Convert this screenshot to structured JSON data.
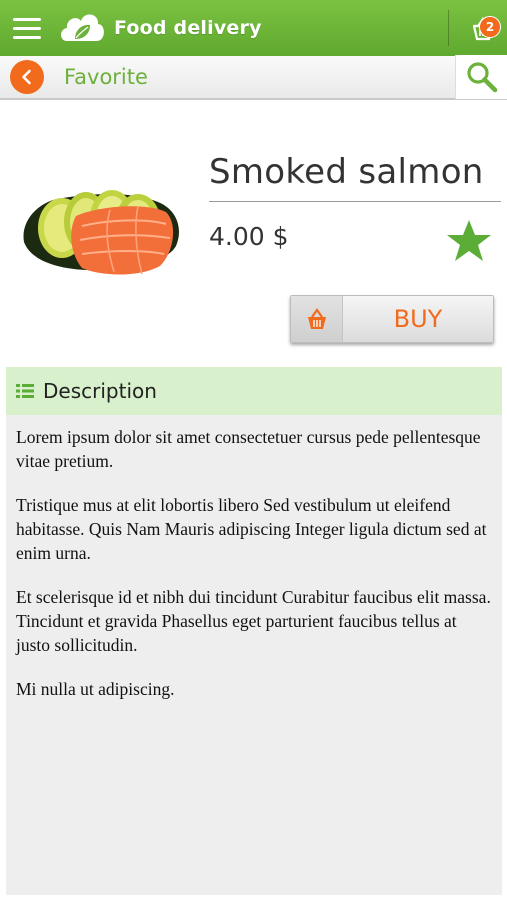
{
  "app": {
    "title": "Food delivery",
    "accent_color": "#6bb13b",
    "cart_count": "2",
    "icons": [
      "menu-icon",
      "cloud-leaf-logo-icon",
      "cart-icon"
    ]
  },
  "subbar": {
    "title": "Favorite",
    "icons": [
      "back-arrow-icon",
      "search-icon"
    ]
  },
  "product": {
    "name": "Smoked salmon",
    "price": "4.00 $",
    "favorite": true,
    "buy_label": "BUY",
    "image": "smoked-salmon-image"
  },
  "description": {
    "header": "Description",
    "paragraphs": [
      "Lorem ipsum dolor sit amet consectetuer cursus pede pellentesque vitae pretium.",
      "Tristique mus at elit lobortis libero Sed vestibulum ut eleifend habitasse. Quis Nam Mauris adipiscing Integer ligula dictum sed at enim urna.",
      "Et scelerisque id et nibh dui tincidunt Curabitur faucibus elit massa. Tincidunt et gravida Phasellus eget parturient faucibus tellus at justo sollicitudin.",
      "Mi nulla ut adipiscing."
    ]
  },
  "colors": {
    "orange": "#f26a1b",
    "green_bar": "#6bb13b",
    "desc_header_bg": "#d8f0cc"
  }
}
